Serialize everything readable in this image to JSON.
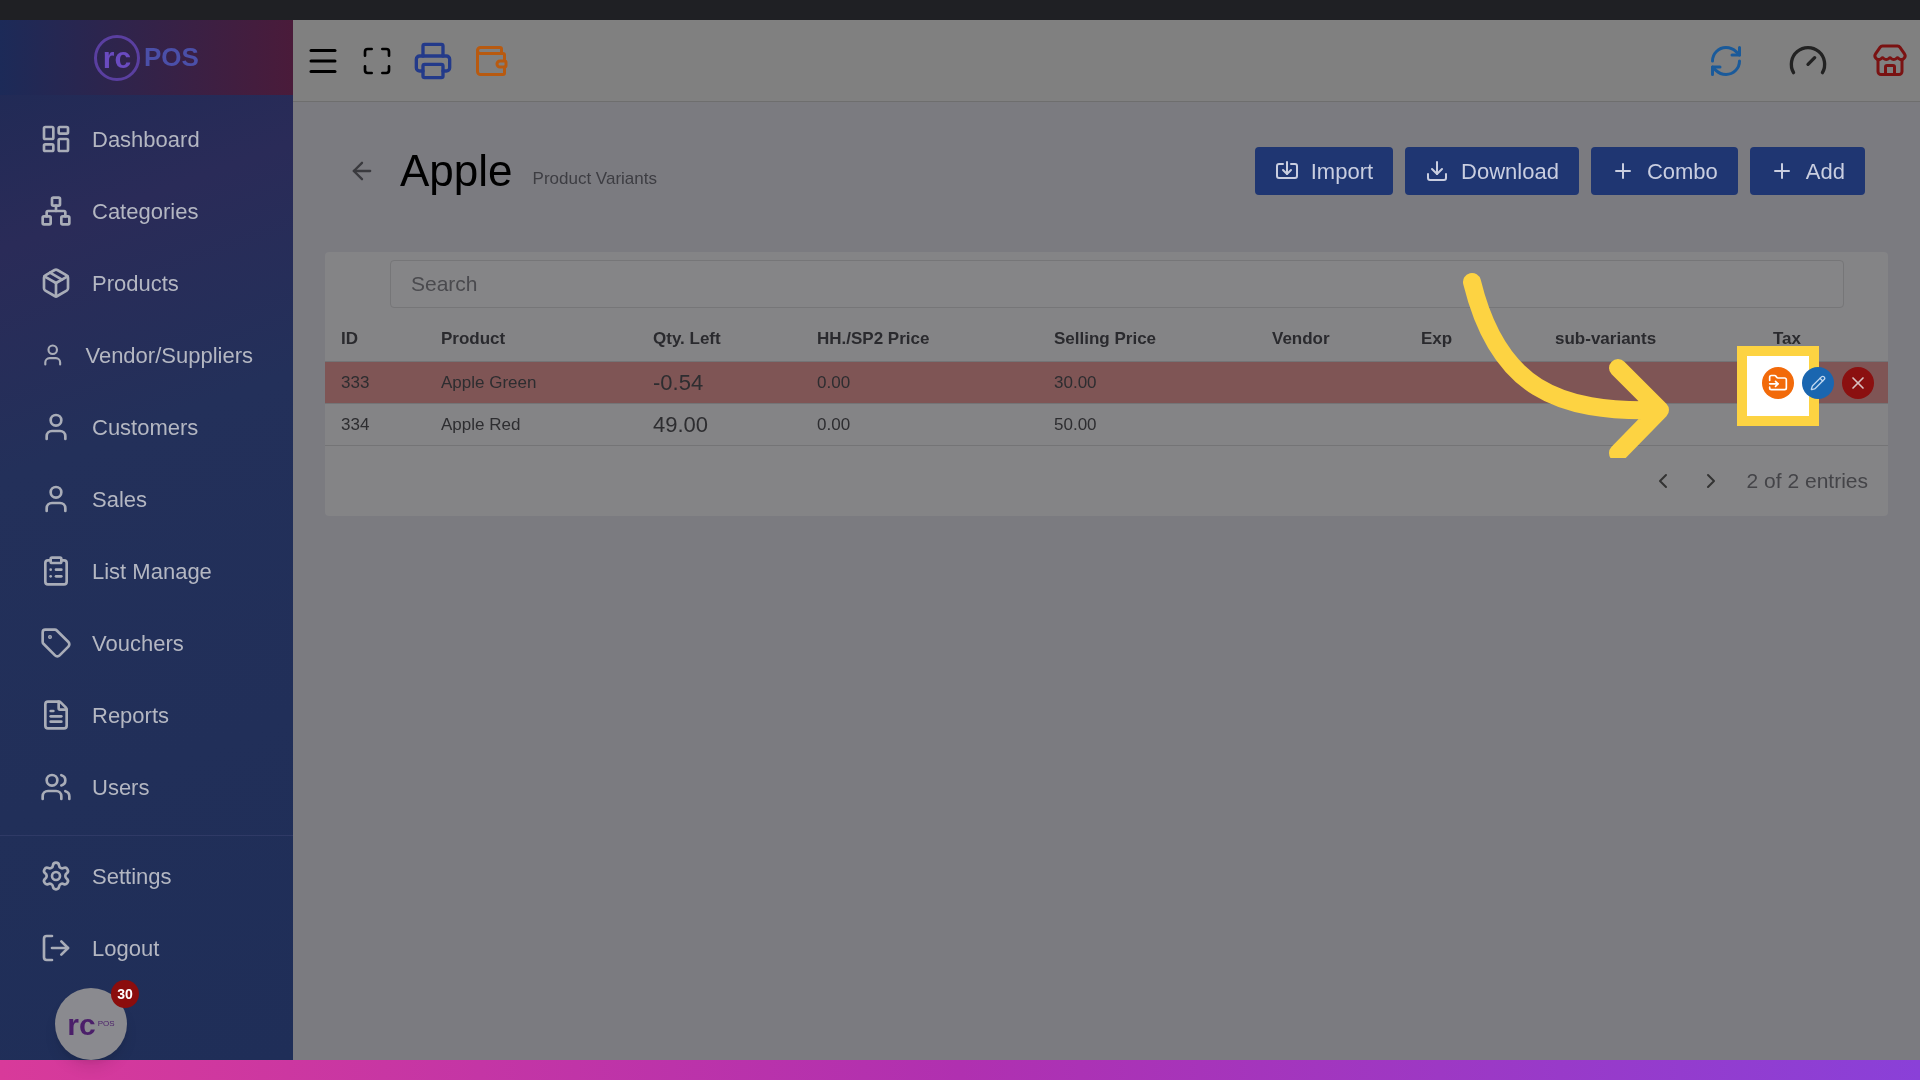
{
  "logo": {
    "mark": "rc",
    "text": "POS"
  },
  "sidebar": {
    "items": [
      {
        "label": "Dashboard",
        "kind": "dashboard",
        "selected": false
      },
      {
        "label": "Categories",
        "kind": "categories",
        "selected": false
      },
      {
        "label": "Products",
        "kind": "products",
        "selected": false
      },
      {
        "label": "Vendor/Suppliers",
        "kind": "person",
        "selected": false
      },
      {
        "label": "Customers",
        "kind": "person",
        "selected": false
      },
      {
        "label": "Sales",
        "kind": "person",
        "selected": false
      },
      {
        "label": "List Manage",
        "kind": "list",
        "selected": false
      },
      {
        "label": "Vouchers",
        "kind": "tag",
        "selected": false
      },
      {
        "label": "Reports",
        "kind": "report",
        "selected": false
      },
      {
        "label": "Users",
        "kind": "users",
        "selected": false
      },
      {
        "label": "Settings",
        "kind": "settings",
        "selected": false
      },
      {
        "label": "Logout",
        "kind": "logout",
        "selected": false
      }
    ]
  },
  "chat_bubble": {
    "mark": "rc",
    "sub": "POS",
    "badge": "30"
  },
  "page": {
    "title": "Apple",
    "subtitle": "Product Variants"
  },
  "actions": [
    {
      "label": "Import",
      "kind": "import"
    },
    {
      "label": "Download",
      "kind": "download"
    },
    {
      "label": "Combo",
      "kind": "plus"
    },
    {
      "label": "Add",
      "kind": "plus"
    }
  ],
  "search": {
    "placeholder": "Search"
  },
  "table": {
    "columns": [
      "ID",
      "Product",
      "Qty. Left",
      "HH./SP2 Price",
      "Selling Price",
      "Vendor",
      "Exp",
      "sub-variants",
      "Tax"
    ],
    "rows": [
      {
        "id": "333",
        "product": "Apple Green",
        "qty": "-0.54",
        "hh": "0.00",
        "selling": "30.00",
        "negative": true,
        "actions": true
      },
      {
        "id": "334",
        "product": "Apple Red",
        "qty": "49.00",
        "hh": "0.00",
        "selling": "50.00",
        "negative": false,
        "actions": false
      }
    ]
  },
  "pagination": {
    "summary": "2 of 2 entries"
  }
}
